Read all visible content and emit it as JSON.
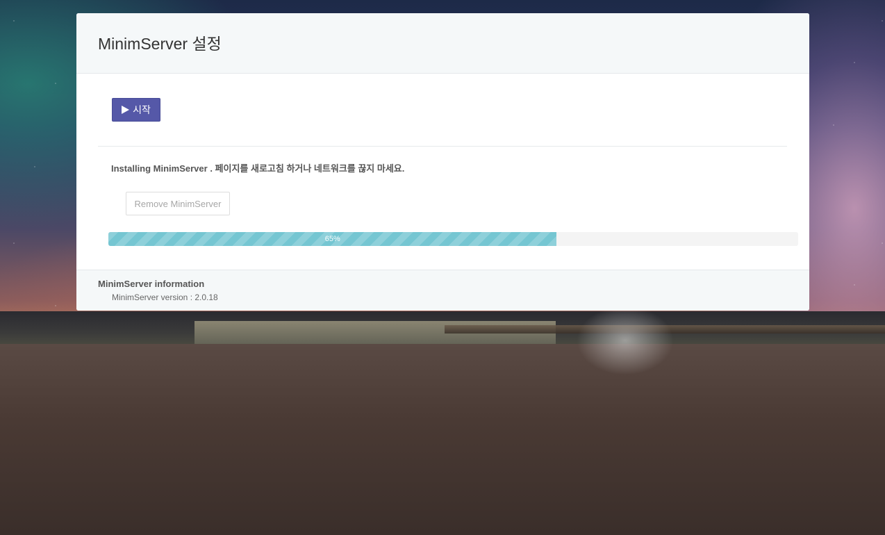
{
  "page": {
    "title": "MinimServer 설정"
  },
  "actions": {
    "start_label": "시작",
    "remove_label": "Remove MinimServer"
  },
  "status": {
    "message": "Installing MinimServer . 페이지를 새로고침 하거나 네트워크를 끊지 마세요."
  },
  "progress": {
    "percent": 65,
    "label": "65%",
    "color": "#75c6d2"
  },
  "footer": {
    "title": "MinimServer information",
    "version": "MinimServer version : 2.0.18"
  },
  "theme": {
    "accent": "#5558a8"
  }
}
